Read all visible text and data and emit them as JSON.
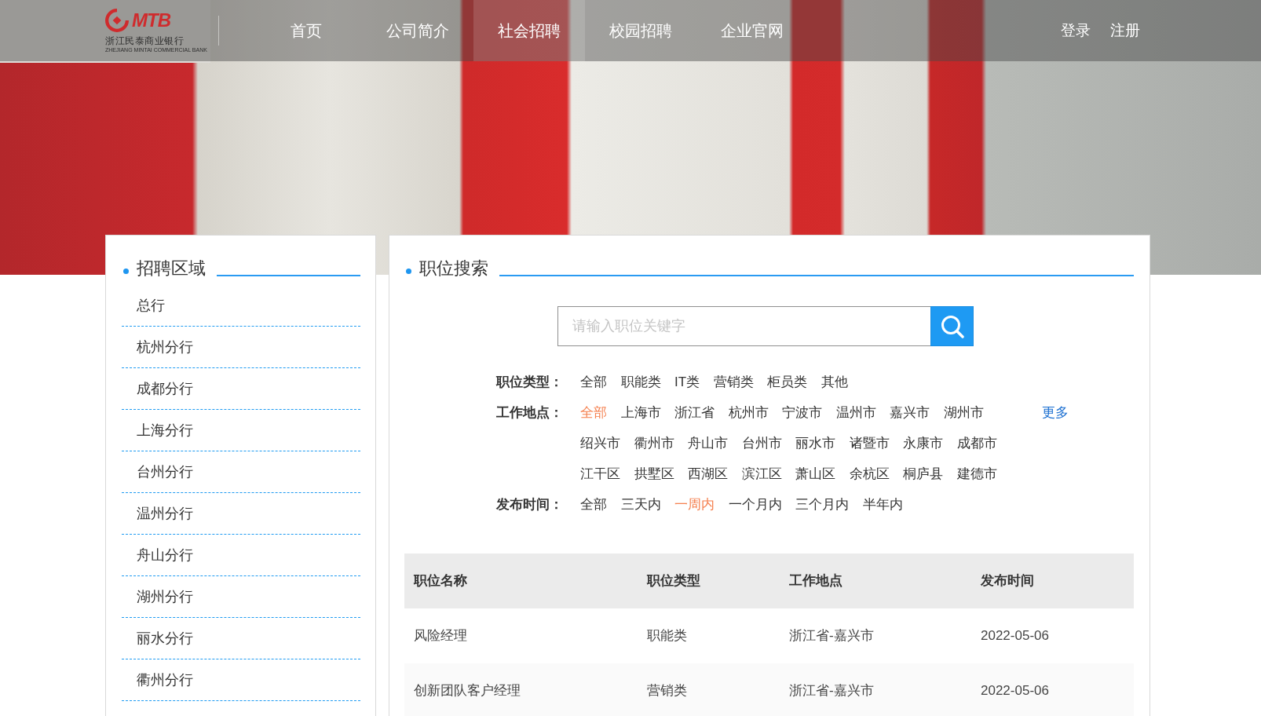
{
  "header": {
    "logo": {
      "wordmark": "MTB",
      "chinese_name": "浙江民泰商业银行",
      "english_name": "ZHEJIANG MINTAI COMMERCIAL BANK"
    },
    "nav": [
      {
        "label": "首页",
        "selected": false
      },
      {
        "label": "公司简介",
        "selected": false
      },
      {
        "label": "社会招聘",
        "selected": true
      },
      {
        "label": "校园招聘",
        "selected": false
      },
      {
        "label": "企业官网",
        "selected": false
      }
    ],
    "account_links": [
      "登录",
      "注册"
    ]
  },
  "region_panel": {
    "title": "招聘区域",
    "items": [
      "总行",
      "杭州分行",
      "成都分行",
      "上海分行",
      "台州分行",
      "温州分行",
      "舟山分行",
      "湖州分行",
      "丽水分行",
      "衢州分行"
    ]
  },
  "search_panel": {
    "title": "职位搜索",
    "search": {
      "placeholder": "请输入职位关键字"
    },
    "filters": [
      {
        "label": "职位类型：",
        "options": [
          {
            "label": "全部",
            "selected": false
          },
          {
            "label": "职能类",
            "selected": false
          },
          {
            "label": "IT类",
            "selected": false
          },
          {
            "label": "营销类",
            "selected": false
          },
          {
            "label": "柜员类",
            "selected": false
          },
          {
            "label": "其他",
            "selected": false
          }
        ]
      },
      {
        "label": "工作地点：",
        "options": [
          {
            "label": "全部",
            "selected": true
          },
          {
            "label": "上海市",
            "selected": false
          },
          {
            "label": "浙江省",
            "selected": false
          },
          {
            "label": "杭州市",
            "selected": false
          },
          {
            "label": "宁波市",
            "selected": false
          },
          {
            "label": "温州市",
            "selected": false
          },
          {
            "label": "嘉兴市",
            "selected": false
          },
          {
            "label": "湖州市",
            "selected": false
          },
          {
            "label": "绍兴市",
            "selected": false
          },
          {
            "label": "衢州市",
            "selected": false
          },
          {
            "label": "舟山市",
            "selected": false
          },
          {
            "label": "台州市",
            "selected": false
          },
          {
            "label": "丽水市",
            "selected": false
          },
          {
            "label": "诸暨市",
            "selected": false
          },
          {
            "label": "永康市",
            "selected": false
          },
          {
            "label": "成都市",
            "selected": false
          },
          {
            "label": "江干区",
            "selected": false
          },
          {
            "label": "拱墅区",
            "selected": false
          },
          {
            "label": "西湖区",
            "selected": false
          },
          {
            "label": "滨江区",
            "selected": false
          },
          {
            "label": "萧山区",
            "selected": false
          },
          {
            "label": "余杭区",
            "selected": false
          },
          {
            "label": "桐庐县",
            "selected": false
          },
          {
            "label": "建德市",
            "selected": false
          }
        ],
        "more": "更多"
      },
      {
        "label": "发布时间：",
        "options": [
          {
            "label": "全部",
            "selected": false
          },
          {
            "label": "三天内",
            "selected": false
          },
          {
            "label": "一周内",
            "selected": true
          },
          {
            "label": "一个月内",
            "selected": false
          },
          {
            "label": "三个月内",
            "selected": false
          },
          {
            "label": "半年内",
            "selected": false
          }
        ]
      }
    ],
    "table": {
      "columns": [
        "职位名称",
        "职位类型",
        "工作地点",
        "发布时间"
      ],
      "rows": [
        [
          "风险经理",
          "职能类",
          "浙江省-嘉兴市",
          "2022-05-06"
        ],
        [
          "创新团队客户经理",
          "营销类",
          "浙江省-嘉兴市",
          "2022-05-06"
        ]
      ]
    }
  }
}
